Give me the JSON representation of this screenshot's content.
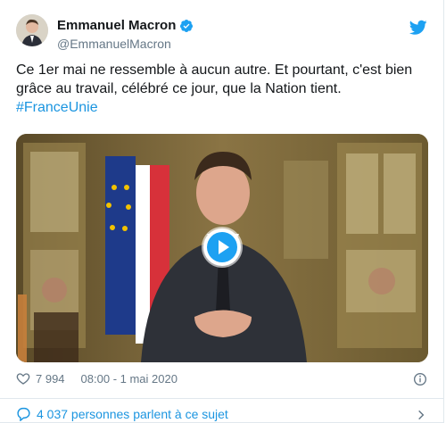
{
  "tweet": {
    "author_name": "Emmanuel Macron",
    "author_handle": "@EmmanuelMacron",
    "text_line": "Ce 1er mai ne ressemble à aucun autre. Et pourtant, c'est bien grâce au travail, célébré ce jour, que la Nation tient.",
    "hashtag": "#FranceUnie",
    "like_count": "7 994",
    "timestamp": "08:00 - 1 mai 2020",
    "conversation_text": "4 037 personnes parlent à ce sujet"
  },
  "icons": {
    "verified": "verified-badge-icon",
    "twitter": "twitter-bird-icon",
    "like": "heart-icon",
    "info": "info-icon",
    "conversation": "speech-bubble-icon",
    "chevron": "chevron-right-icon",
    "play": "play-icon"
  },
  "colors": {
    "accent": "#1b95e0",
    "text": "#14171a",
    "muted": "#657786",
    "border": "#e1e8ed"
  }
}
